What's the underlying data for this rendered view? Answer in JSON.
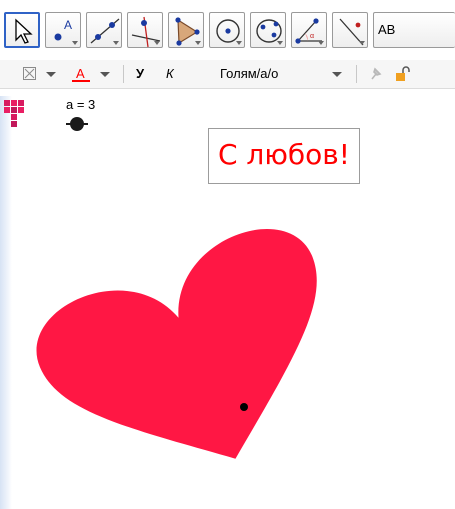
{
  "toolbar": {
    "tools": [
      {
        "name": "move-tool",
        "icon": "cursor-arrow-icon"
      },
      {
        "name": "point-tool",
        "icon": "point-a-icon"
      },
      {
        "name": "line-tool",
        "icon": "line-through-points-icon"
      },
      {
        "name": "perpendicular-tool",
        "icon": "perpendicular-line-icon"
      },
      {
        "name": "polygon-tool",
        "icon": "polygon-icon"
      },
      {
        "name": "circle-tool",
        "icon": "circle-center-icon"
      },
      {
        "name": "conic-tool",
        "icon": "ellipse-icon"
      },
      {
        "name": "angle-tool",
        "icon": "angle-icon"
      },
      {
        "name": "reflect-tool",
        "icon": "reflect-line-icon"
      },
      {
        "name": "text-tool",
        "icon": "text-ab-icon"
      }
    ],
    "text_tool_label": "AB"
  },
  "stylebar": {
    "bold_label": "У",
    "italic_label": "К",
    "size_value": "Голям/а/о",
    "text_color": "#ff0000"
  },
  "slider": {
    "label": "a = 3"
  },
  "canvas": {
    "text_label": "С любов!",
    "heart_color": "#ff1744"
  }
}
